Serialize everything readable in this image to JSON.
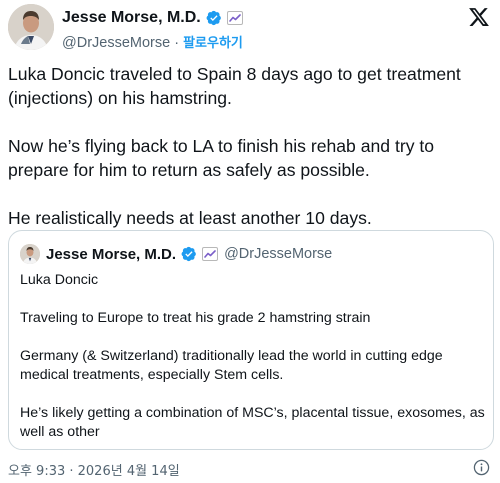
{
  "author": {
    "name": "Jesse Morse, M.D.",
    "handle": "@DrJesseMorse",
    "separator": "·",
    "follow_label": "팔로우하기",
    "avatar_icon": "profile-photo",
    "verified_icon": "verified-badge-icon",
    "affiliation_icon": "affiliation-badge-icon"
  },
  "tweet": {
    "paragraphs": [
      "Luka Doncic traveled to Spain 8 days ago to get treatment (injections) on his hamstring.",
      "Now he’s flying back to LA to finish his rehab and try to prepare for him to return as safely as possible.",
      "He realistically needs at least another 10 days."
    ]
  },
  "quote": {
    "name": "Jesse Morse, M.D.",
    "handle": "@DrJesseMorse",
    "paragraphs": [
      "Luka Doncic",
      "Traveling to Europe to treat his grade 2 hamstring strain",
      "Germany (& Switzerland) traditionally lead the world in cutting edge medical treatments, especially Stem cells.",
      "He’s likely getting a combination of MSC’s, placental tissue, exosomes, as well as other"
    ]
  },
  "footer": {
    "timestamp": "오후 9:33 · 2026년 4월 14일"
  },
  "colors": {
    "text": "#0f1419",
    "secondary": "#536471",
    "accent": "#1d9bf0",
    "border": "#cfd9de"
  }
}
